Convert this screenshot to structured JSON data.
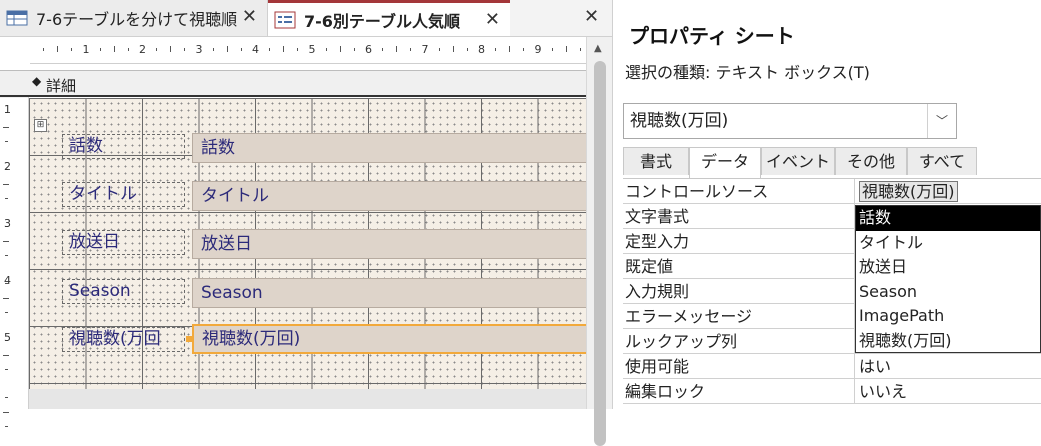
{
  "tabs": [
    {
      "label": "7-6テーブルを分けて視聴順",
      "active": false
    },
    {
      "label": "7-6別テーブル人気順",
      "active": true
    }
  ],
  "ruler": {
    "h_numbers": [
      "1",
      "2",
      "3",
      "4",
      "5",
      "6",
      "7",
      "8",
      "9"
    ],
    "v_numbers": [
      "1",
      "2",
      "3",
      "4",
      "5"
    ]
  },
  "section": {
    "label": "詳細"
  },
  "controls": [
    {
      "label": "話数",
      "box": "話数"
    },
    {
      "label": "タイトル",
      "box": "タイトル"
    },
    {
      "label": "放送日",
      "box": "放送日"
    },
    {
      "label": "Season",
      "box": "Season"
    },
    {
      "label": "視聴数(万回",
      "box": "視聴数(万回)"
    }
  ],
  "props": {
    "title": "プロパティ シート",
    "selection_type": "選択の種類:  テキスト ボックス(T)",
    "object": "視聴数(万回)",
    "tabs": [
      "書式",
      "データ",
      "イベント",
      "その他",
      "すべて"
    ],
    "active_tab": 1,
    "rows": [
      {
        "name": "コントロールソース",
        "value": "視聴数(万回)"
      },
      {
        "name": "文字書式",
        "value": ""
      },
      {
        "name": "定型入力",
        "value": ""
      },
      {
        "name": "既定値",
        "value": ""
      },
      {
        "name": "入力規則",
        "value": ""
      },
      {
        "name": "エラーメッセージ",
        "value": ""
      },
      {
        "name": "ルックアップ列",
        "value": ""
      },
      {
        "name": "使用可能",
        "value": "はい"
      },
      {
        "name": "編集ロック",
        "value": "いいえ"
      }
    ],
    "dropdown": [
      "話数",
      "タイトル",
      "放送日",
      "Season",
      "ImagePath",
      "視聴数(万回)"
    ],
    "dropdown_selected": 0
  },
  "colors": {
    "selection": "#f2a93b",
    "control_text": "#2c2a7a",
    "tab_accent": "#a4373a"
  }
}
